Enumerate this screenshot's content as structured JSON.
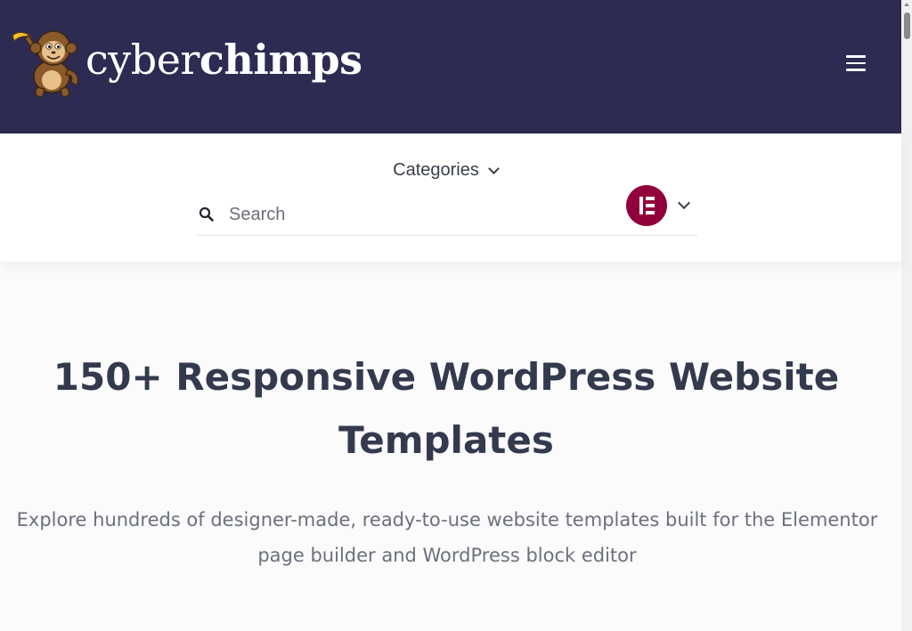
{
  "header": {
    "logo_text_light": "cyber",
    "logo_text_bold": "chimps",
    "background_color": "#2d2b52",
    "logo_icon": "chimp-mascot-icon",
    "menu_icon": "hamburger-menu-icon"
  },
  "filters": {
    "categories_label": "Categories",
    "categories_icon": "chevron-down-icon",
    "search": {
      "placeholder": "Search",
      "value": "",
      "icon": "search-icon"
    },
    "page_builder": {
      "selected_icon": "elementor-icon",
      "brand_color": "#92003b",
      "dropdown_icon": "chevron-down-icon"
    }
  },
  "hero": {
    "title": "150+ Responsive WordPress Website Templates",
    "subtitle": "Explore hundreds of designer-made, ready-to-use website templates built for the Elementor page builder and WordPress block editor"
  }
}
